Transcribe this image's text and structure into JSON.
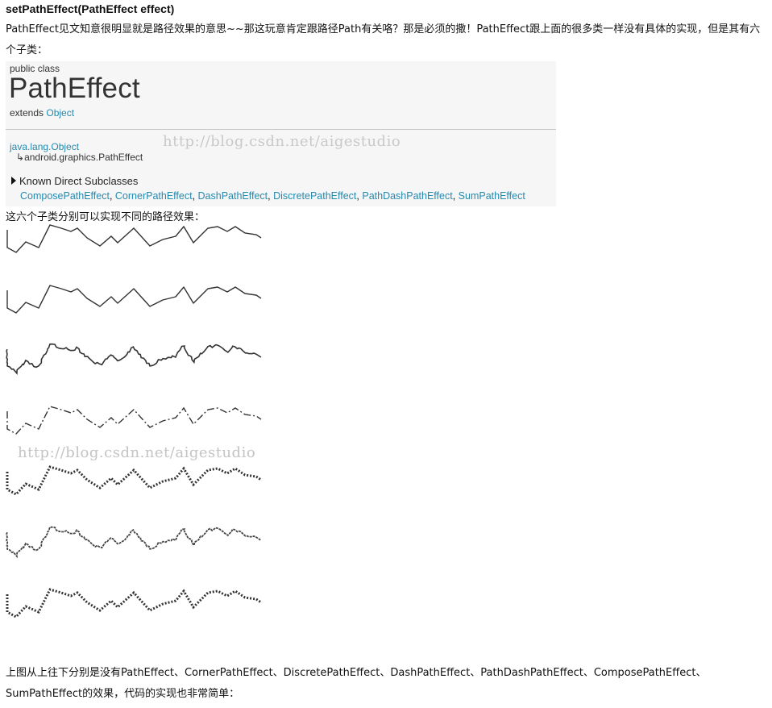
{
  "heading": "setPathEffect(PathEffect effect)",
  "intro": "PathEffect见文知意很明显就是路径效果的意思~~那这玩意肯定跟路径Path有关咯？那是必须的撒！PathEffect跟上面的很多类一样没有具体的实现，但是其有六个子类：",
  "doc": {
    "modifier": "public class",
    "class_name": "PathEffect",
    "extends_label": "extends",
    "extends_link": "Object",
    "inherit_root": "java.lang.Object",
    "inherit_arrow": "↳",
    "inherit_child": "android.graphics.PathEffect",
    "toggle_icon": "triangle-right-icon",
    "known_label": "Known Direct Subclasses",
    "subclasses": [
      "ComposePathEffect",
      "CornerPathEffect",
      "DashPathEffect",
      "DiscretePathEffect",
      "PathDashPathEffect",
      "SumPathEffect"
    ]
  },
  "watermark": "http://blog.csdn.net/aigestudio",
  "para2": "这六个子类分别可以实现不同的路径效果：",
  "para3": "上图从上往下分别是没有PathEffect、CornerPathEffect、DiscretePathEffect、DashPathEffect、PathDashPathEffect、ComposePathEffect、SumPathEffect的效果，代码的实现也非常简单：",
  "colors": {
    "link": "#258aaf",
    "line": "#333333",
    "box_bg": "#f6f6f6",
    "watermark": "#c9c9c9"
  }
}
